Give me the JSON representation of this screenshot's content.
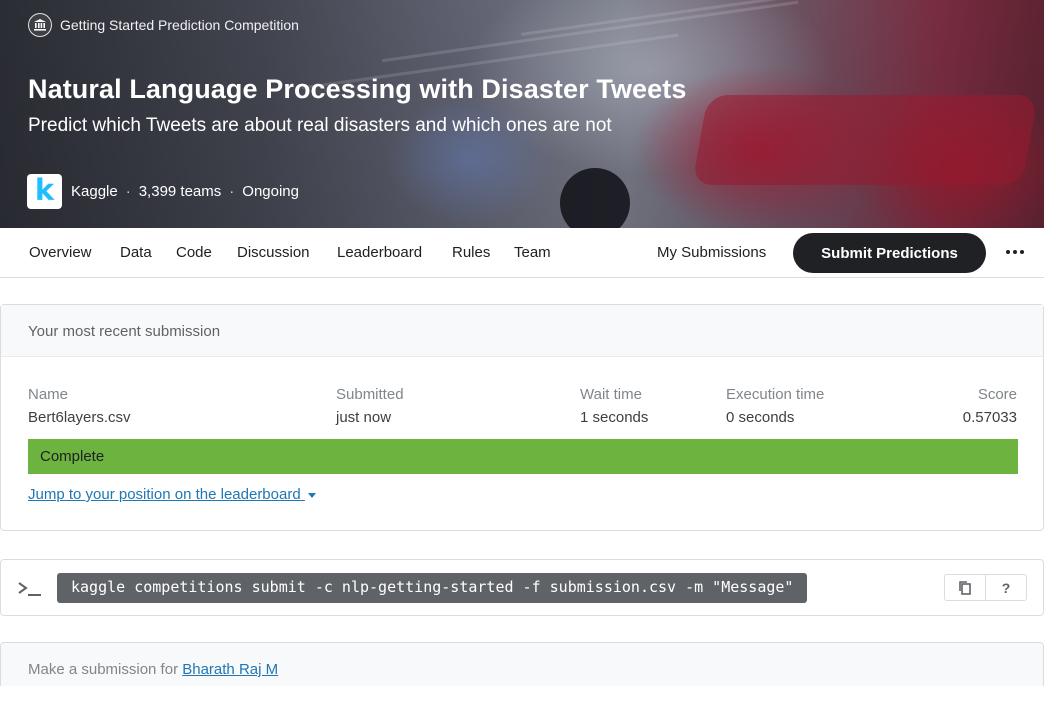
{
  "hero": {
    "competition_type": "Getting Started Prediction Competition",
    "competition_type_icon": "institution-icon",
    "title": "Natural Language Processing with Disaster Tweets",
    "subtitle": "Predict which Tweets are about real disasters and which ones are not",
    "host_logo_letter": "k",
    "host": "Kaggle",
    "teams": "3,399 teams",
    "status": "Ongoing",
    "separator": "·"
  },
  "nav": {
    "tabs": [
      "Overview",
      "Data",
      "Code",
      "Discussion",
      "Leaderboard",
      "Rules",
      "Team"
    ],
    "my_submissions": "My Submissions",
    "submit_predictions": "Submit Predictions",
    "more_icon": "more-horizontal-icon"
  },
  "recent_submission": {
    "header": "Your most recent submission",
    "labels": {
      "name": "Name",
      "submitted": "Submitted",
      "wait_time": "Wait time",
      "execution_time": "Execution time",
      "score": "Score"
    },
    "values": {
      "name": "Bert6layers.csv",
      "submitted": "just now",
      "wait_time": "1 seconds",
      "execution_time": "0 seconds",
      "score": "0.57033"
    },
    "status": "Complete",
    "status_color": "#6db33f",
    "jump_link": "Jump to your position on the leaderboard"
  },
  "cli": {
    "prompt_icon": "terminal-prompt-icon",
    "command": "kaggle competitions submit -c nlp-getting-started -f submission.csv -m \"Message\"",
    "copy_icon": "copy-icon",
    "help_label": "?"
  },
  "make_submission": {
    "prefix": "Make a submission for",
    "user": "Bharath Raj M"
  }
}
